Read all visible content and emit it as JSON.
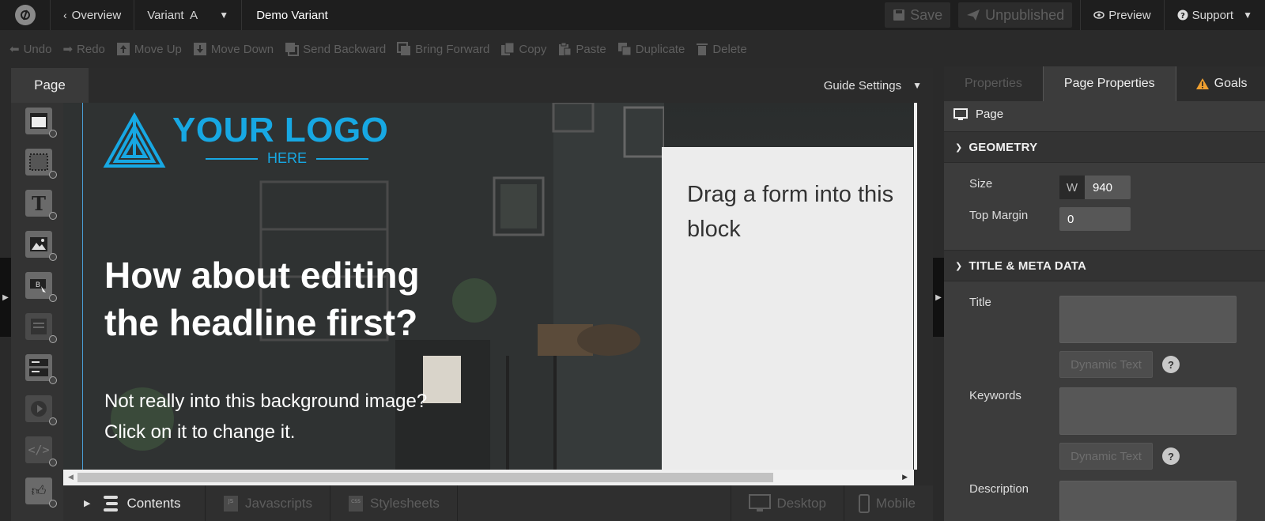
{
  "topbar": {
    "overview_label": "Overview",
    "variant_label": "Variant  A",
    "demo_title": "Demo Variant",
    "save_label": "Save",
    "unpublished_label": "Unpublished",
    "preview_label": "Preview",
    "support_label": "Support"
  },
  "toolbar": {
    "undo": "Undo",
    "redo": "Redo",
    "move_up": "Move Up",
    "move_down": "Move Down",
    "send_backward": "Send Backward",
    "bring_forward": "Bring Forward",
    "copy": "Copy",
    "paste": "Paste",
    "duplicate": "Duplicate",
    "delete": "Delete"
  },
  "canvas": {
    "page_tab": "Page",
    "guide_settings": "Guide Settings",
    "logo_main": "YOUR LOGO",
    "logo_sub": "HERE",
    "headline": "How about editing the headline first?",
    "subtext": "Not really into this background image? Click on it to change it.",
    "form_placeholder": "Drag a form into this block"
  },
  "bottombar": {
    "contents": "Contents",
    "javascripts": "Javascripts",
    "stylesheets": "Stylesheets",
    "desktop": "Desktop",
    "mobile": "Mobile"
  },
  "panel": {
    "tabs": {
      "properties": "Properties",
      "page_properties": "Page Properties",
      "goals": "Goals"
    },
    "page_header": "Page",
    "geometry": {
      "title": "GEOMETRY",
      "size_label": "Size",
      "width_prefix": "W",
      "width_value": "940",
      "top_margin_label": "Top Margin",
      "top_margin_value": "0"
    },
    "meta": {
      "title": "TITLE & META DATA",
      "title_label": "Title",
      "keywords_label": "Keywords",
      "description_label": "Description",
      "dynamic_text": "Dynamic Text",
      "help": "?"
    }
  },
  "colors": {
    "accent_logo": "#17a8e3",
    "guide_line": "#4a9fd6",
    "warning": "#f0a030"
  }
}
